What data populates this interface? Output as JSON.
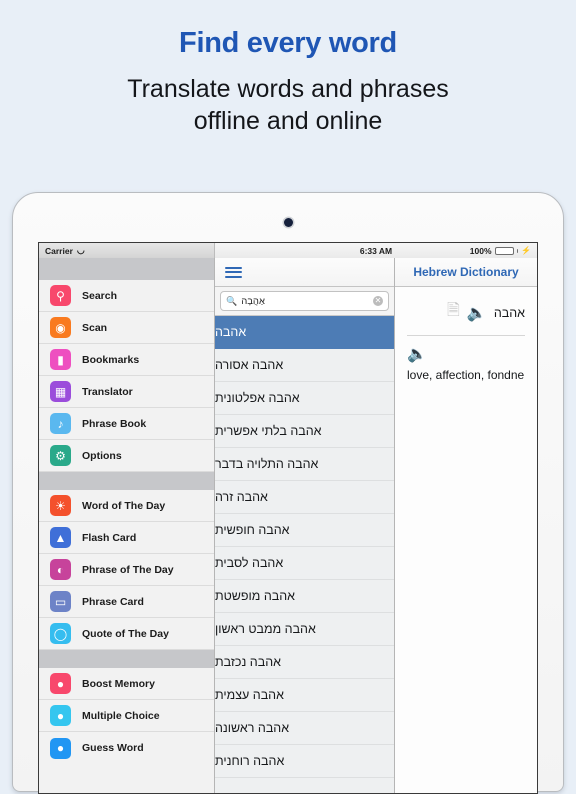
{
  "promo": {
    "title": "Find every word",
    "subtitle_line1": "Translate words and phrases",
    "subtitle_line2": "offline and online",
    "title_color": "#1f56b4",
    "background_color": "#e8eff7"
  },
  "statusbar": {
    "carrier": "Carrier",
    "wifi_icon": "wifi-icon",
    "time": "6:33 AM",
    "battery_percent": "100%",
    "battery_color": "#4cd760",
    "charging_icon": "lightning-bolt-icon"
  },
  "sidebar": {
    "groups": [
      {
        "items": [
          {
            "label": "Search",
            "icon": "magnifier-icon",
            "color": "#f8486c"
          },
          {
            "label": "Scan",
            "icon": "camera-icon",
            "color": "#f97a1f"
          },
          {
            "label": "Bookmarks",
            "icon": "bookmark-icon",
            "color": "#ee4fc0"
          },
          {
            "label": "Translator",
            "icon": "translator-icon",
            "color": "#9b4ddb"
          },
          {
            "label": "Phrase Book",
            "icon": "speech-wave-icon",
            "color": "#5ab8ef"
          },
          {
            "label": "Options",
            "icon": "gear-icon",
            "color": "#2aa98a"
          }
        ]
      },
      {
        "items": [
          {
            "label": "Word of The Day",
            "icon": "sun-icon",
            "color": "#f4512c"
          },
          {
            "label": "Flash Card",
            "icon": "inbox-icon",
            "color": "#3f6fd8"
          },
          {
            "label": "Phrase of The Day",
            "icon": "chat-bubble-icon",
            "color": "#c7439b"
          },
          {
            "label": "Phrase Card",
            "icon": "monitor-icon",
            "color": "#6d83c7"
          },
          {
            "label": "Quote of The Day",
            "icon": "quote-bubble-icon",
            "color": "#35bdef"
          }
        ]
      },
      {
        "items": [
          {
            "label": "Boost Memory",
            "icon": "person-icon",
            "color": "#f8486c"
          },
          {
            "label": "Multiple Choice",
            "icon": "people-group-icon",
            "color": "#35c6ef"
          },
          {
            "label": "Guess Word",
            "icon": "person-blue-icon",
            "color": "#2196f3"
          }
        ]
      }
    ]
  },
  "navbar": {
    "menu_icon": "hamburger-menu-icon",
    "title": "Hebrew Dictionary",
    "title_color": "#2f68b5"
  },
  "search": {
    "icon": "search-icon",
    "value": "אַהֲבָה",
    "clear_icon": "clear-circle-icon"
  },
  "wordlist": {
    "selected_index": 0,
    "selected_color": "#4d7cb5",
    "items": [
      "אהבה",
      "אהבה אסורה",
      "אהבה אפלטונית",
      "אהבה בלתי אפשרית",
      "אהבה התלויה בדבר",
      "אהבה זרה",
      "אהבה חופשית",
      "אהבה לסבית",
      "אהבה מופשטת",
      "אהבה ממבט ראשון",
      "אהבה נכזבת",
      "אהבה עצמית",
      "אהבה ראשונה",
      "אהבה רוחנית"
    ]
  },
  "detail": {
    "headword": "אהבה",
    "speaker_icon": "speaker-icon",
    "document_icon": "document-icon",
    "translation_speaker_icon": "speaker-icon",
    "translation": "love, affection, fondne"
  }
}
